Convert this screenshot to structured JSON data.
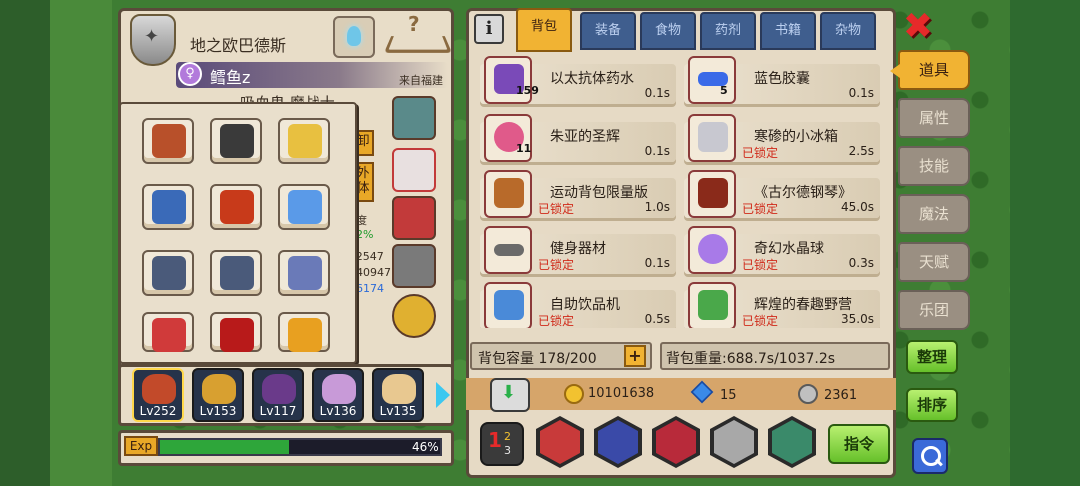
{
  "character": {
    "rank_title": "地之欧巴德斯",
    "name": "鳕鱼z",
    "origin": "来自福建",
    "partial_title": "吸血鬼 魔战士",
    "side_tags": [
      "卸",
      "外体"
    ],
    "partial_stats": [
      "度",
      "2%",
      "/2547",
      "40947",
      "6174"
    ]
  },
  "hero_roster": [
    {
      "level": "Lv252",
      "color": "#c24a2a"
    },
    {
      "level": "Lv153",
      "color": "#d8a030"
    },
    {
      "level": "Lv117",
      "color": "#6a3a8a"
    },
    {
      "level": "Lv136",
      "color": "#c89ad8"
    },
    {
      "level": "Lv135",
      "color": "#e8c890"
    }
  ],
  "exp": {
    "label": "Exp",
    "percent": 46,
    "percent_text": "46%"
  },
  "inventory": {
    "tabs": [
      "背包",
      "装备",
      "食物",
      "药剂",
      "书籍",
      "杂物"
    ],
    "active_tab": "背包",
    "items": [
      {
        "name": "以太抗体药水",
        "count": "159",
        "locked": "",
        "weight": "0.1s",
        "color": "#7a4ab8"
      },
      {
        "name": "蓝色胶囊",
        "count": "5",
        "locked": "",
        "weight": "0.1s",
        "color": "#3a6ae8"
      },
      {
        "name": "朱亚的圣辉",
        "count": "11",
        "locked": "",
        "weight": "0.1s",
        "color": "#e05a8a"
      },
      {
        "name": "寒碜的小冰箱",
        "count": "",
        "locked": "已锁定",
        "weight": "2.5s",
        "color": "#c8c8d0"
      },
      {
        "name": "运动背包限量版",
        "count": "",
        "locked": "已锁定",
        "weight": "1.0s",
        "color": "#b86a2a"
      },
      {
        "name": "《古尔德钢琴》",
        "count": "",
        "locked": "已锁定",
        "weight": "45.0s",
        "color": "#8a2a1a"
      },
      {
        "name": "健身器材",
        "count": "",
        "locked": "已锁定",
        "weight": "0.1s",
        "color": "#6a6a6a"
      },
      {
        "name": "奇幻水晶球",
        "count": "",
        "locked": "已锁定",
        "weight": "0.3s",
        "color": "#a87ae8"
      },
      {
        "name": "自助饮品机",
        "count": "",
        "locked": "已锁定",
        "weight": "0.5s",
        "color": "#4a8ad8"
      },
      {
        "name": "辉煌的春趣野营",
        "count": "",
        "locked": "已锁定",
        "weight": "35.0s",
        "color": "#4aa84a"
      }
    ],
    "capacity_text": "背包容量 178/200",
    "weight_text": "背包重量:688.7s/1037.2s"
  },
  "currency": {
    "gold": "10101638",
    "gems": "15",
    "tokens": "2361"
  },
  "bottom_actions": {
    "command_label": "指令"
  },
  "nav": {
    "items": [
      "道具",
      "属性",
      "技能",
      "魔法",
      "天赋",
      "乐团"
    ],
    "active": "道具",
    "organize_label": "整理",
    "sort_label": "排序"
  }
}
